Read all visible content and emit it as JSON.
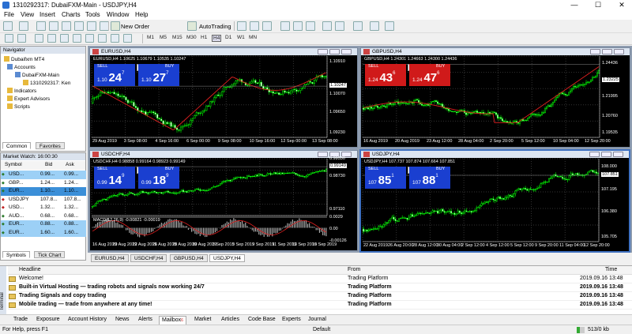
{
  "window": {
    "title": "1310292317: DubaiFXM-Main - USDJPY,H4",
    "min": "—",
    "max": "☐",
    "close": "✕"
  },
  "menu": [
    "File",
    "View",
    "Insert",
    "Charts",
    "Tools",
    "Window",
    "Help"
  ],
  "toolbar": {
    "new_order": "New Order",
    "autotrading": "AutoTrading",
    "timeframes": [
      "M1",
      "M5",
      "M15",
      "M30",
      "H1",
      "H4",
      "D1",
      "W1",
      "MN"
    ]
  },
  "navigator": {
    "title": "Navigator",
    "items": [
      {
        "label": "Dubaifxm MT4"
      },
      {
        "label": "Accounts"
      },
      {
        "label": "DubaiFXM-Main"
      },
      {
        "label": "1310292317: Ken"
      },
      {
        "label": "Indicators"
      },
      {
        "label": "Expert Advisors"
      },
      {
        "label": "Scripts"
      }
    ],
    "tabs": [
      "Common",
      "Favorites"
    ]
  },
  "market_watch": {
    "title": "Market Watch: 16:00:30",
    "columns": [
      "Symbol",
      "Bid",
      "Ask"
    ],
    "rows": [
      {
        "symbol": "USD...",
        "bid": "0.99...",
        "ask": "0.99...",
        "c": "#9cd0f6",
        "arrow": "#2a7a2a"
      },
      {
        "symbol": "GBP...",
        "bid": "1.24...",
        "ask": "1.24...",
        "c": "#ffffff",
        "arrow": "#2a7a2a"
      },
      {
        "symbol": "EUR...",
        "bid": "1.10...",
        "ask": "1.10...",
        "c": "#3b8fd8",
        "arrow": "#2a7a2a"
      },
      {
        "symbol": "USDJPY",
        "bid": "107.8...",
        "ask": "107.8...",
        "c": "#ffffff",
        "arrow": "#c02020"
      },
      {
        "symbol": "USD...",
        "bid": "1.32...",
        "ask": "1.32...",
        "c": "#ffffff",
        "arrow": "#c02020"
      },
      {
        "symbol": "AUD...",
        "bid": "0.68...",
        "ask": "0.68...",
        "c": "#ffffff",
        "arrow": "#2a7a2a"
      },
      {
        "symbol": "EUR...",
        "bid": "0.88...",
        "ask": "0.88...",
        "c": "#9cd0f6",
        "arrow": "#2a7a2a"
      },
      {
        "symbol": "EUR...",
        "bid": "1.60...",
        "ask": "1.60...",
        "c": "#9cd0f6",
        "arrow": "#2a7a2a"
      }
    ],
    "tabs": [
      "Symbols",
      "Tick Chart"
    ]
  },
  "charts": [
    {
      "title": "EURUSD,H4",
      "info": "EURUSD,H4  1.10625 1.10679 1.10535 1.10247",
      "sell": "SELL",
      "buy": "BUY",
      "lot": "1.00",
      "sell_price": {
        "pre": "1.10",
        "big": "24",
        "sup": "7"
      },
      "buy_price": {
        "pre": "1.10",
        "big": "27",
        "sup": "7"
      },
      "yticks": [
        "1.10910",
        "1.10247",
        "1.10070",
        "1.09650",
        "1.09230"
      ],
      "xticks": [
        "29 Aug 2019",
        "3 Sep 08:00",
        "4 Sep 16:00",
        "6 Sep 00:00",
        "9 Sep 08:00",
        "10 Sep 16:00",
        "12 Sep 00:00",
        "13 Sep 08:00"
      ],
      "sell_color": "#1a3fd0",
      "buy_color": "#1a3fd0"
    },
    {
      "title": "GBPUSD,H4",
      "info": "GBPUSD,H4  1.24301 1.24663 1.24300 1.24436",
      "sell": "SELL",
      "buy": "BUY",
      "lot": "1.00",
      "sell_price": {
        "pre": "1.24",
        "big": "43",
        "sup": "6"
      },
      "buy_price": {
        "pre": "1.24",
        "big": "47",
        "sup": "6"
      },
      "yticks": [
        "1.24436",
        "1.23225",
        "1.21995",
        "1.20760",
        "1.19535"
      ],
      "xticks": [
        "16 Aug 2019",
        "20 Aug 2019",
        "23 Aug 12:00",
        "28 Aug 04:00",
        "2 Sep 20:00",
        "5 Sep 12:00",
        "10 Sep 04:00",
        "12 Sep 20:00"
      ],
      "sell_color": "#d01a1a",
      "buy_color": "#d01a1a"
    },
    {
      "title": "USDCHF,H4",
      "info": "USDCHF,H4  0.98858 0.99164 0.98923 0.99149",
      "sell": "SELL",
      "buy": "BUY",
      "lot": "1.00",
      "sell_price": {
        "pre": "0.99",
        "big": "14",
        "sup": "9"
      },
      "buy_price": {
        "pre": "0.99",
        "big": "18",
        "sup": "9"
      },
      "yticks": [
        "0.99530",
        "0.99149",
        "0.98730",
        "0.97110"
      ],
      "macd_label": "MACD(12,26,9) -0.00821 -0.00019",
      "macd_ticks": [
        "0.0029",
        "0.00",
        "-0.00126"
      ],
      "xticks": [
        "16 Aug 2019",
        "20 Aug 2019",
        "22 Aug 2019",
        "26 Aug 2019",
        "28 Aug 2019",
        "30 Aug 2019",
        "3 Sep 2019",
        "5 Sep 2019",
        "9 Sep 2019",
        "11 Sep 2019",
        "13 Sep 2019",
        "16 Sep 2019"
      ],
      "sell_color": "#1a3fd0",
      "buy_color": "#1a3fd0"
    },
    {
      "title": "USDJPY,H4",
      "info": "USDJPY,H4  107.737 107.874 107.664 107.851",
      "sell": "SELL",
      "buy": "BUY",
      "lot": "1.00",
      "sell_price": {
        "pre": "107",
        "big": "85",
        "sup": "1"
      },
      "buy_price": {
        "pre": "107",
        "big": "88",
        "sup": "1"
      },
      "yticks": [
        "108.000",
        "107.851",
        "107.195",
        "106.380",
        "105.705"
      ],
      "xticks": [
        "22 Aug 2019",
        "26 Aug 20:00",
        "28 Aug 12:00",
        "30 Aug 04:00",
        "2 Sep 12:00",
        "4 Sep 12:00",
        "5 Sep 12:00",
        "9 Sep 20:00",
        "11 Sep 04:00",
        "12 Sep 20:00"
      ],
      "sell_color": "#1a3fd0",
      "buy_color": "#1a3fd0"
    }
  ],
  "chart_tabs": [
    "EURUSD,H4",
    "USDCHF,H4",
    "GBPUSD,H4",
    "USDJPY,H4"
  ],
  "terminal": {
    "headers": {
      "headline": "Headline",
      "from": "From",
      "time": "Time"
    },
    "rows": [
      {
        "headline": "Welcome!",
        "from": "Trading Platform",
        "time": "2019.09.16 13:48",
        "bold": false
      },
      {
        "headline": "Built-in Virtual Hosting — trading robots and signals now working 24/7",
        "from": "Trading Platform",
        "time": "2019.09.16 13:48",
        "bold": true
      },
      {
        "headline": "Trading Signals and copy trading",
        "from": "Trading Platform",
        "time": "2019.09.16 13:48",
        "bold": true
      },
      {
        "headline": "Mobile trading — trade from anywhere at any time!",
        "from": "Trading Platform",
        "time": "2019.09.16 13:48",
        "bold": true
      }
    ],
    "tabs": [
      "Trade",
      "Exposure",
      "Account History",
      "News",
      "Alerts",
      "Mailbox",
      "Market",
      "Articles",
      "Code Base",
      "Experts",
      "Journal"
    ],
    "mailbox_badge": "6",
    "side_label": "Terminal"
  },
  "status": {
    "help": "For Help, press F1",
    "profile": "Default",
    "traffic": "513/0 kb"
  }
}
